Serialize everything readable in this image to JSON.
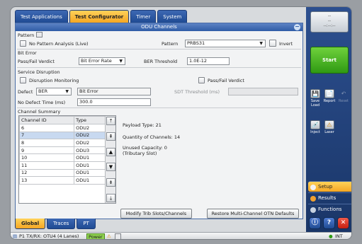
{
  "tabs": [
    "Test Applications",
    "Test Configurator",
    "Timer",
    "System"
  ],
  "active_tab": "Test Configurator",
  "panel_title": "ODU Channels",
  "pattern": {
    "section": "Pattern",
    "no_pattern_label": "No Pattern Analysis (Live)",
    "pattern_label": "Pattern",
    "pattern_value": "PRBS31",
    "invert_label": "Invert"
  },
  "bit_error": {
    "section": "Bit Error",
    "verdict_label": "Pass/Fail Verdict",
    "verdict_value": "Bit Error Rate",
    "threshold_label": "BER Threshold",
    "threshold_value": "1.0E-12"
  },
  "service_disruption": {
    "section": "Service Disruption",
    "monitoring_label": "Disruption Monitoring",
    "verdict_label": "Pass/Fail Verdict",
    "defect_label": "Defect",
    "defect_value": "BER",
    "defect_text": "Bit Error",
    "sdt_label": "SDT Threshold (ms)",
    "sdt_value": "",
    "no_defect_label": "No Defect Time (ms)",
    "no_defect_value": "300.0"
  },
  "channel_summary": {
    "section": "Channel Summary",
    "columns": [
      "Channel ID",
      "Type"
    ],
    "rows": [
      {
        "id": "6",
        "type": "ODU2"
      },
      {
        "id": "7",
        "type": "ODU2"
      },
      {
        "id": "8",
        "type": "ODU2"
      },
      {
        "id": "9",
        "type": "ODU3"
      },
      {
        "id": "10",
        "type": "ODU1"
      },
      {
        "id": "11",
        "type": "ODU1"
      },
      {
        "id": "12",
        "type": "ODU1"
      },
      {
        "id": "13",
        "type": "ODU1"
      }
    ],
    "selected_row": 1,
    "payload_label": "Payload Type:",
    "payload_value": "21",
    "quantity_label": "Quantity of Channels:",
    "quantity_value": "14",
    "unused_label": "Unused Capacity:",
    "unused_value": "0",
    "unused_unit": "(Tributary Slot)",
    "modify_button": "Modify Trib Slots/Channels",
    "restore_button": "Restore Multi-Channel OTN Defaults"
  },
  "bottom_tabs": [
    "Global",
    "Traces",
    "PT"
  ],
  "active_bottom_tab": "Global",
  "side": {
    "display_top": "--",
    "display_mid": "--",
    "display_time": "--:--:--",
    "start_label": "Start",
    "icons": [
      {
        "label": "Save Load",
        "glyph": "💾"
      },
      {
        "label": "Report",
        "glyph": "📄"
      },
      {
        "label": "Reset",
        "glyph": "↶"
      },
      {
        "label": "Inject",
        "glyph": "💉"
      },
      {
        "label": "Laser",
        "glyph": "⚠"
      }
    ],
    "menu": [
      "Setup",
      "Results",
      "Functions"
    ],
    "active_menu": "Setup"
  },
  "status": {
    "port": "P1 TX/RX: OTU4 (4 Lanes)",
    "power": "Power",
    "int": "INT"
  },
  "colors": {
    "accent": "#f5a623",
    "brand": "#2f5ca6",
    "start": "#3faf1e",
    "power": "#8fd14f"
  }
}
